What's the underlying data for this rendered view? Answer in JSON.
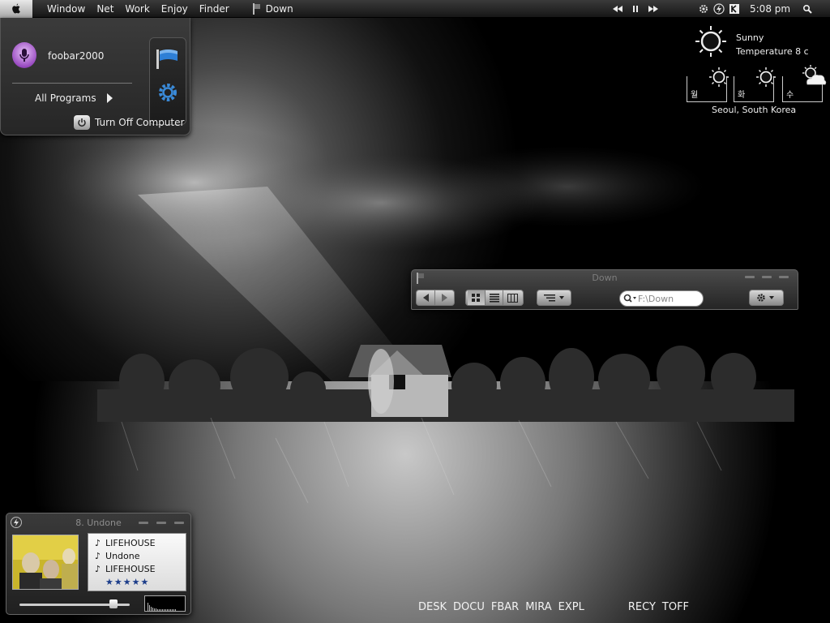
{
  "menubar": {
    "menus": [
      "Window",
      "Net",
      "Work",
      "Enjoy",
      "Finder"
    ],
    "active_window": "Down",
    "clock": "5:08 pm"
  },
  "icons": {
    "apple": "apple-icon",
    "prev": "previous-track-icon",
    "pause": "pause-icon",
    "next": "next-track-icon",
    "spotlight": "search-icon"
  },
  "start_menu": {
    "user_name": "foobar2000",
    "all_programs": "All Programs",
    "turn_off": "Turn Off Computer"
  },
  "weather": {
    "condition": "Sunny",
    "temperature": "Temperature 8 c",
    "location": "Seoul, South Korea",
    "forecast": [
      {
        "day": "월",
        "icon": "sun-icon"
      },
      {
        "day": "화",
        "icon": "sun-icon"
      },
      {
        "day": "수",
        "icon": "partly-cloudy-icon"
      }
    ]
  },
  "explorer": {
    "title": "Down",
    "address": "F:\\Down"
  },
  "player": {
    "title": "8. Undone",
    "artist": "LIFEHOUSE",
    "track": "Undone",
    "album": "LIFEHOUSE",
    "rating": "★★★★★",
    "rating_value": 5,
    "volume": 0.85
  },
  "shortcuts": [
    "DESK",
    "DOCU",
    "FBAR",
    "MIRA",
    "EXPL"
  ],
  "shortcuts_right": [
    "RECY",
    "TOFF"
  ],
  "colors": {
    "menubar": "#1e1e1e",
    "accent_blue": "#2e7fd6",
    "avatar_purple": "#9a4cc2"
  }
}
